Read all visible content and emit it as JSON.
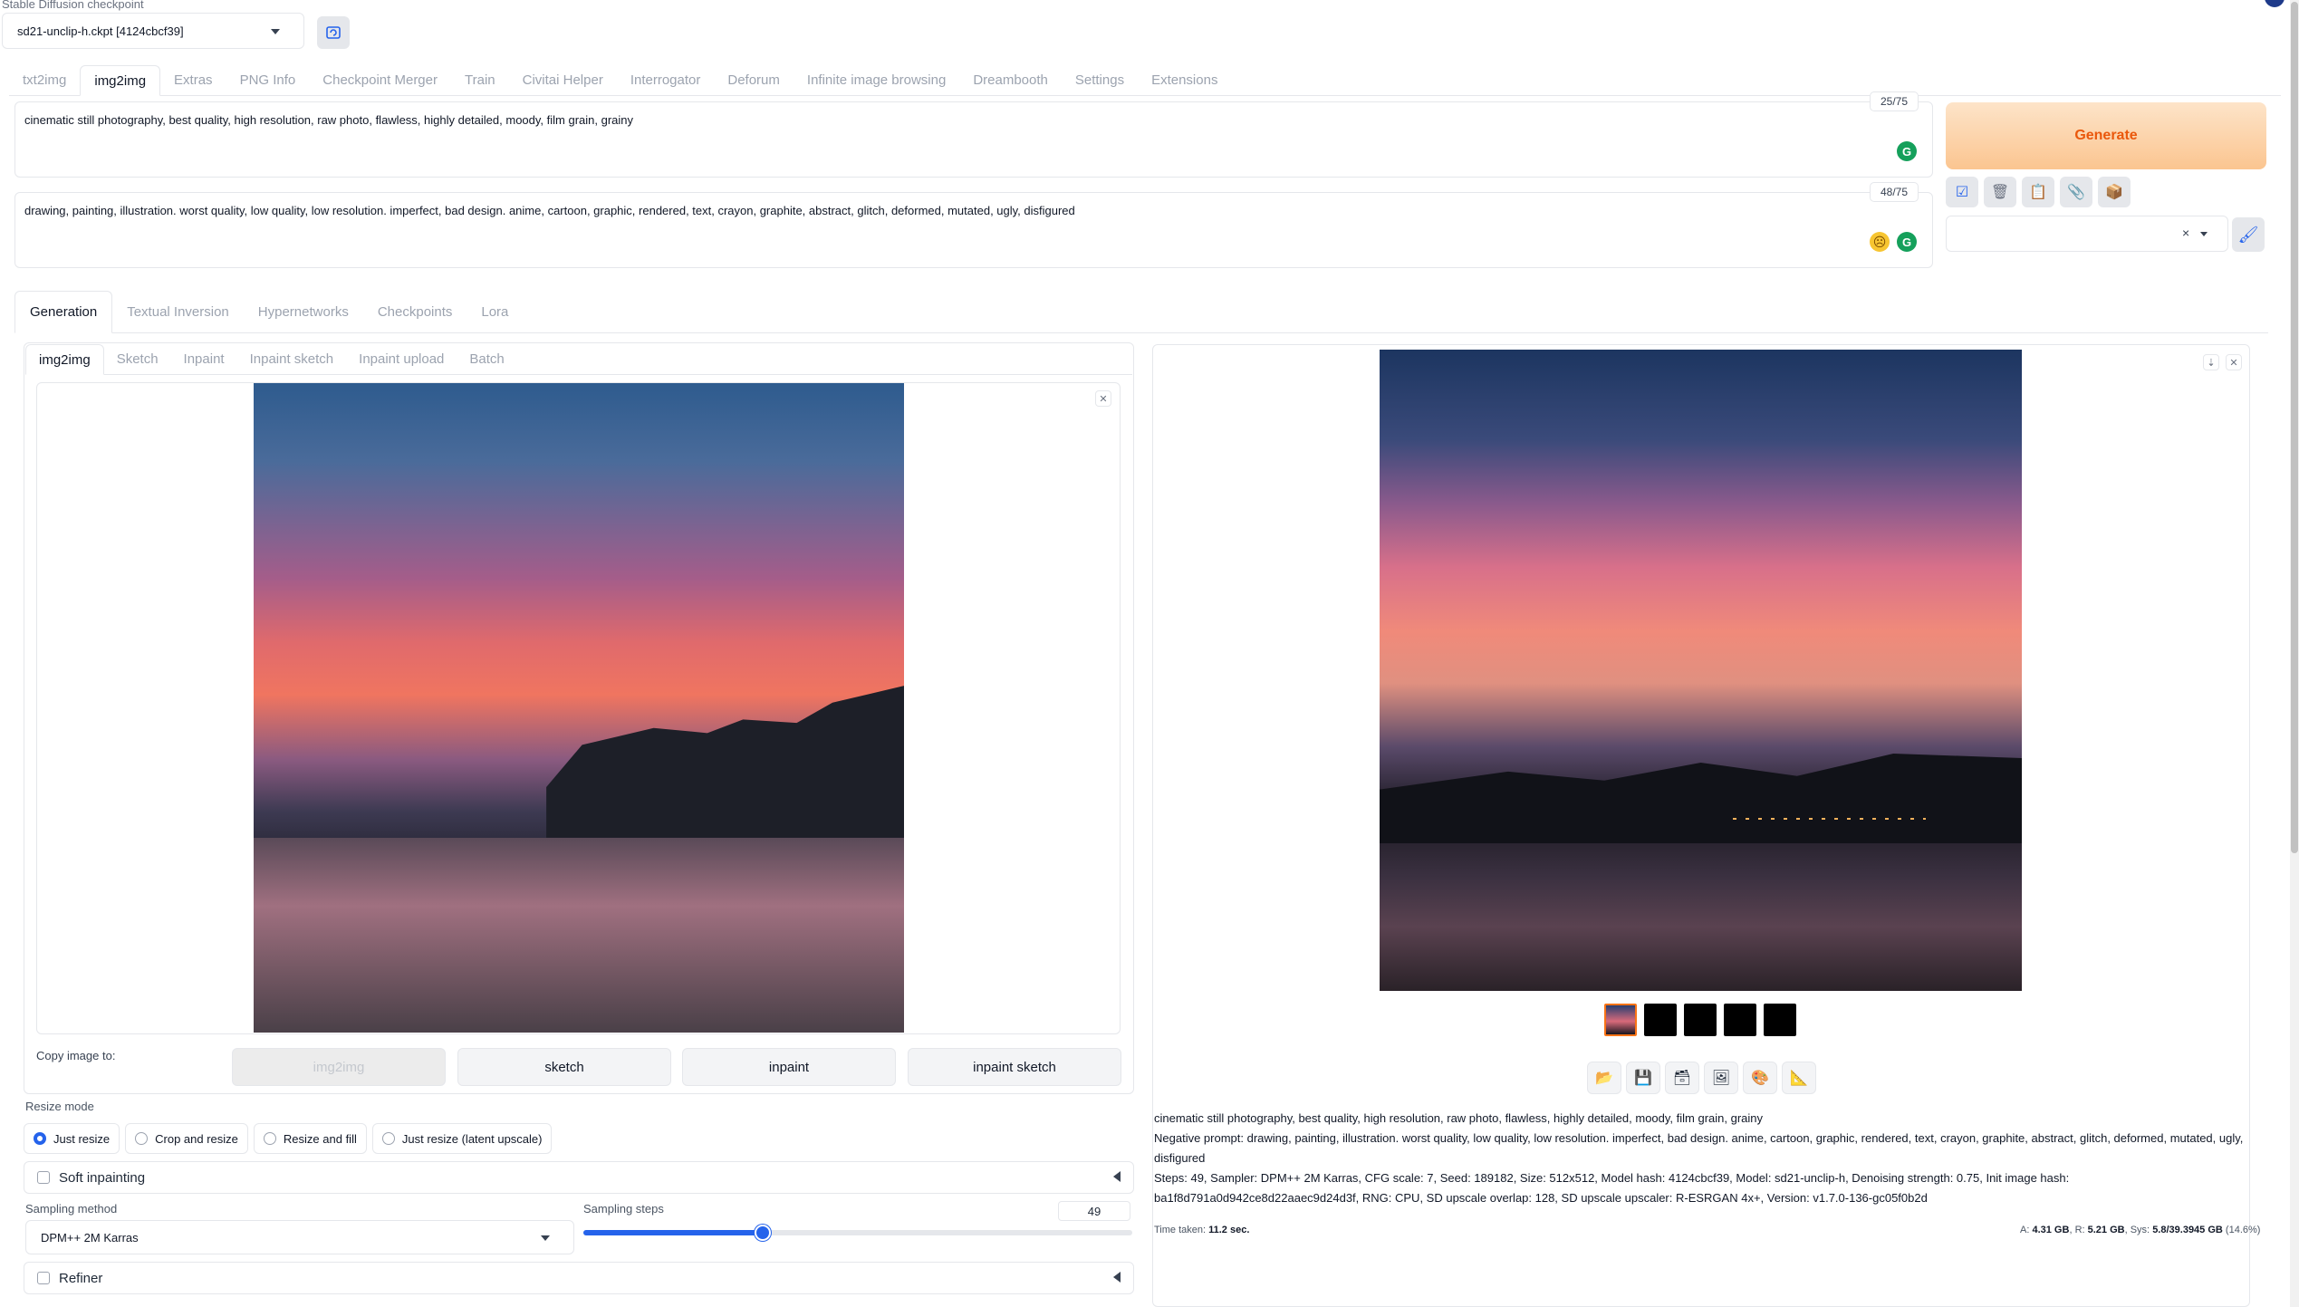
{
  "checkpoint": {
    "label": "Stable Diffusion checkpoint",
    "value": "sd21-unclip-h.ckpt [4124cbcf39]"
  },
  "main_tabs": [
    "txt2img",
    "img2img",
    "Extras",
    "PNG Info",
    "Checkpoint Merger",
    "Train",
    "Civitai Helper",
    "Interrogator",
    "Deforum",
    "Infinite image browsing",
    "Dreambooth",
    "Settings",
    "Extensions"
  ],
  "prompt": {
    "positive": "cinematic still photography, best quality, high resolution, raw photo, flawless, highly detailed, moody, film grain, grainy",
    "positive_tokens": "25/75",
    "negative": "drawing, painting, illustration. worst quality, low quality, low resolution. imperfect, bad design. anime, cartoon, graphic, rendered, text, crayon, graphite, abstract, glitch, deformed, mutated, ugly, disfigured",
    "negative_tokens": "48/75"
  },
  "generate_label": "Generate",
  "sub_tabs": [
    "Generation",
    "Textual Inversion",
    "Hypernetworks",
    "Checkpoints",
    "Lora"
  ],
  "image_tabs": [
    "img2img",
    "Sketch",
    "Inpaint",
    "Inpaint sketch",
    "Inpaint upload",
    "Batch"
  ],
  "copy_image": {
    "label": "Copy image to:",
    "buttons": [
      "img2img",
      "sketch",
      "inpaint",
      "inpaint sketch"
    ]
  },
  "resize_mode": {
    "label": "Resize mode",
    "options": [
      "Just resize",
      "Crop and resize",
      "Resize and fill",
      "Just resize (latent upscale)"
    ],
    "selected": "Just resize"
  },
  "soft_inpainting": "Soft inpainting",
  "sampling": {
    "method_label": "Sampling method",
    "method": "DPM++ 2M Karras",
    "steps_label": "Sampling steps",
    "steps": 49,
    "steps_max": 150
  },
  "refiner": "Refiner",
  "output_info": {
    "prompt": "cinematic still photography, best quality, high resolution, raw photo, flawless, highly detailed, moody, film grain, grainy",
    "negative": "Negative prompt: drawing, painting, illustration. worst quality, low quality, low resolution. imperfect, bad design. anime, cartoon, graphic, rendered, text, crayon, graphite, abstract, glitch, deformed, mutated, ugly, disfigured",
    "params": "Steps: 49, Sampler: DPM++ 2M Karras, CFG scale: 7, Seed: 189182, Size: 512x512, Model hash: 4124cbcf39, Model: sd21-unclip-h, Denoising strength: 0.75, Init image hash: ba1f8d791a0d942ce8d22aaec9d24d3f, RNG: CPU, SD upscale overlap: 128, SD upscale upscaler: R-ESRGAN 4x+, Version: v1.7.0-136-gc05f0b2d",
    "time_label": "Time taken:",
    "time_value": "11.2 sec.",
    "mem_a_label": "A:",
    "mem_a": "4.31 GB",
    "mem_r_label": "R:",
    "mem_r": "5.21 GB",
    "mem_sys_label": "Sys:",
    "mem_sys": "5.8/39.3945 GB",
    "mem_pct": "(14.6%)"
  },
  "icons": {
    "refresh": "refresh-icon",
    "tools": [
      "checkbox-icon",
      "trash-icon",
      "clipboard-icon",
      "paperclip-icon",
      "box-icon"
    ],
    "paint": "paintbrush-icon",
    "output_tools": [
      "folder-icon",
      "save-icon",
      "zip-icon",
      "image-icon",
      "palette-icon",
      "ruler-icon"
    ]
  },
  "colors": {
    "accent": "#2563eb",
    "generate_text": "#ea580c",
    "grammarly": "#15a05b"
  }
}
